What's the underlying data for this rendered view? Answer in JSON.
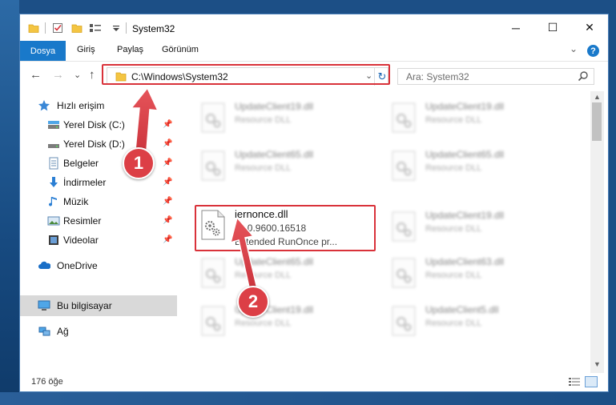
{
  "window": {
    "title": "System32",
    "minimize_glyph": "─",
    "maximize_glyph": "☐",
    "close_glyph": "✕"
  },
  "ribbon": {
    "tabs": [
      "Dosya",
      "Giriş",
      "Paylaş",
      "Görünüm"
    ],
    "help_glyph": "?",
    "collapse_glyph": "⌄"
  },
  "address": {
    "back_glyph": "←",
    "forward_glyph": "→",
    "recent_glyph": "⌄",
    "up_glyph": "↑",
    "path": "C:\\Windows\\System32",
    "dropdown_glyph": "⌄",
    "refresh_glyph": "↻"
  },
  "search": {
    "placeholder": "Ara: System32"
  },
  "nav": {
    "quick_access": "Hızlı erişim",
    "items": [
      {
        "label": "Yerel Disk (C:)",
        "icon": "drive-icon"
      },
      {
        "label": "Yerel Disk (D:)",
        "icon": "drive-icon"
      },
      {
        "label": "Belgeler",
        "icon": "documents-icon"
      },
      {
        "label": "İndirmeler",
        "icon": "downloads-icon"
      },
      {
        "label": "Müzik",
        "icon": "music-icon"
      },
      {
        "label": "Resimler",
        "icon": "pictures-icon"
      },
      {
        "label": "Videolar",
        "icon": "videos-icon"
      }
    ],
    "onedrive": "OneDrive",
    "this_pc": "Bu bilgisayar",
    "network": "Ağ"
  },
  "files": {
    "left_col": [
      {
        "name": "UpdateClient19.dll",
        "sub": "Resource DLL"
      },
      {
        "name": "UpdateClient65.dll",
        "sub": "Resource DLL"
      },
      {
        "name": "iernonce.dll",
        "version": "11.0.9600.16518",
        "sub": "Extended RunOnce pr..."
      },
      {
        "name": "UpdateClient65.dll",
        "sub": "Resource DLL"
      },
      {
        "name": "UpdateClient19.dll",
        "sub": "Resource DLL"
      }
    ],
    "right_col": [
      {
        "name": "UpdateClient19.dll",
        "sub": "Resource DLL"
      },
      {
        "name": "UpdateClient65.dll",
        "sub": "Resource DLL"
      },
      {
        "name": "UpdateClient19.dll",
        "sub": "Resource DLL"
      },
      {
        "name": "UpdateClient63.dll",
        "sub": "Resource DLL"
      },
      {
        "name": "UpdateClient5.dll",
        "sub": "Resource DLL"
      }
    ]
  },
  "status": {
    "count": "176 öğe"
  },
  "callouts": {
    "one": "1",
    "two": "2"
  },
  "colors": {
    "accent": "#1979ca",
    "highlight": "#d9323a",
    "callout": "#dc3f46"
  }
}
